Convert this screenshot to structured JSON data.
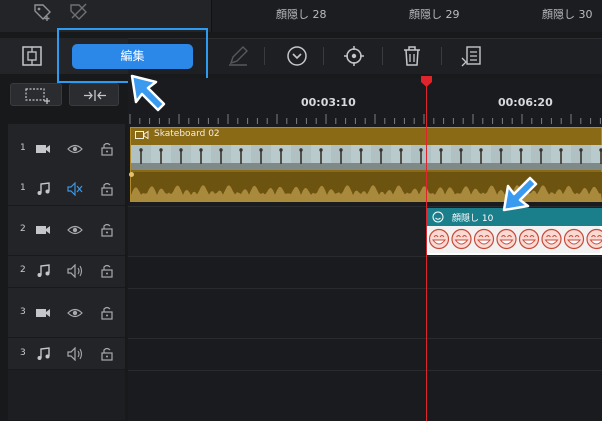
{
  "top_strip": {
    "labels": [
      "顔隠し 28",
      "顔隠し 29",
      "顔隠し 30"
    ]
  },
  "toolbar": {
    "edit_label": "編集"
  },
  "ruler": {
    "labels": [
      "00:03:10",
      "00:06:20"
    ]
  },
  "tracks": [
    {
      "num": "1",
      "type": "video"
    },
    {
      "num": "1",
      "type": "audio"
    },
    {
      "num": "2",
      "type": "video"
    },
    {
      "num": "2",
      "type": "audio"
    },
    {
      "num": "3",
      "type": "video"
    },
    {
      "num": "3",
      "type": "audio"
    }
  ],
  "clips": {
    "skateboard_title": "Skateboard 02",
    "mask_title": "顔隠し 10"
  },
  "colors": {
    "accent": "#2b88e8",
    "highlight": "#2e9bf0",
    "video_clip": "#8a6a14",
    "mask_clip_head": "#1a7f8b",
    "playhead": "#e0242b"
  },
  "icons": {
    "toolbar": [
      "crop-icon",
      "pen-icon",
      "chevron-down-circle-icon",
      "target-icon",
      "trash-icon",
      "list-icon"
    ],
    "track_controls": [
      "camera-icon",
      "eye-icon",
      "lock-icon",
      "music-note-icon",
      "speaker-icon",
      "mute-speaker-icon"
    ]
  }
}
